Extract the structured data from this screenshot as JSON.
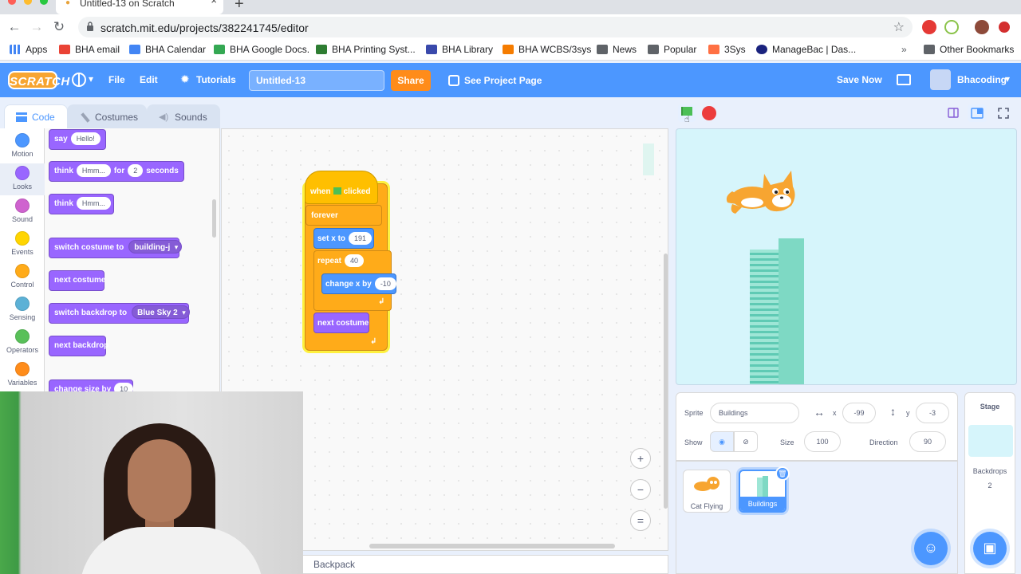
{
  "browser": {
    "tab_title": "Untitled-13 on Scratch",
    "url": "scratch.mit.edu/projects/382241745/editor",
    "bookmarks": [
      "Apps",
      "BHA email",
      "BHA Calendar",
      "BHA Google Docs.",
      "BHA Printing Syst...",
      "BHA Library",
      "BHA WCBS/3sys",
      "News",
      "Popular",
      "3Sys",
      "ManageBac | Das...",
      "Other Bookmarks"
    ]
  },
  "menu": {
    "logo": "SCRATCH",
    "file": "File",
    "edit": "Edit",
    "tutorials": "Tutorials",
    "project_title": "Untitled-13",
    "share": "Share",
    "see_project": "See Project Page",
    "save_now": "Save Now",
    "username": "Bhacoding"
  },
  "tabs": {
    "code": "Code",
    "costumes": "Costumes",
    "sounds": "Sounds"
  },
  "categories": [
    {
      "label": "Motion",
      "color": "#4c97ff"
    },
    {
      "label": "Looks",
      "color": "#9966ff"
    },
    {
      "label": "Sound",
      "color": "#cf63cf"
    },
    {
      "label": "Events",
      "color": "#ffd500"
    },
    {
      "label": "Control",
      "color": "#ffab19"
    },
    {
      "label": "Sensing",
      "color": "#5cb1d6"
    },
    {
      "label": "Operators",
      "color": "#59c059"
    },
    {
      "label": "Variables",
      "color": "#ff8c1a"
    }
  ],
  "palette": {
    "say": "say",
    "say_val": "Hello!",
    "think_for": "think",
    "think_for_val": "Hmm...",
    "for": "for",
    "secs_val": "2",
    "seconds": "seconds",
    "think": "think",
    "think_val": "Hmm...",
    "switch_costume": "switch costume to",
    "costume_val": "building-j",
    "next_costume": "next costume",
    "switch_backdrop": "switch backdrop to",
    "backdrop_val": "Blue Sky 2",
    "next_backdrop": "next backdrop",
    "change_size": "change size by",
    "size_val": "10"
  },
  "script": {
    "when": "when",
    "clicked": "clicked",
    "forever": "forever",
    "set_x": "set x to",
    "set_x_val": "191",
    "repeat": "repeat",
    "repeat_val": "40",
    "change_x": "change x by",
    "change_x_val": "-10",
    "next_costume": "next costume"
  },
  "zoom": {
    "in": "+",
    "out": "−",
    "reset": "="
  },
  "backpack": "Backpack",
  "sprite_info": {
    "sprite_label": "Sprite",
    "sprite_name": "Buildings",
    "x_label": "x",
    "x_val": "-99",
    "y_label": "y",
    "y_val": "-3",
    "show_label": "Show",
    "size_label": "Size",
    "size_val": "100",
    "direction_label": "Direction",
    "direction_val": "90"
  },
  "sprites": [
    {
      "name": "Cat Flying",
      "selected": false
    },
    {
      "name": "Buildings",
      "selected": true
    }
  ],
  "stage_pane": {
    "title": "Stage",
    "backdrops_label": "Backdrops",
    "backdrops_count": "2"
  }
}
